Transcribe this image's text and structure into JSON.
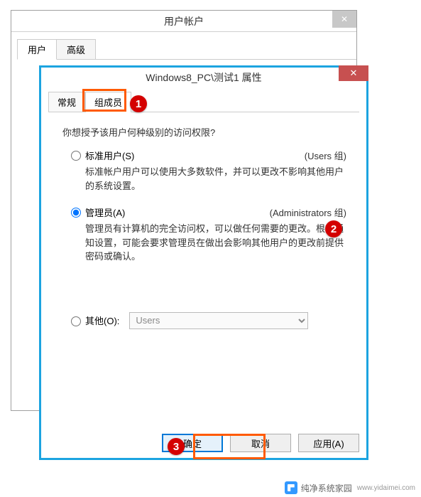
{
  "back_window": {
    "title": "用户帐户",
    "close": "✕",
    "tabs": [
      {
        "label": "用户"
      },
      {
        "label": "高级"
      }
    ]
  },
  "front_window": {
    "title": "Windows8_PC\\测试1 属性",
    "close": "✕",
    "tabs": [
      {
        "label": "常规"
      },
      {
        "label": "组成员"
      }
    ],
    "prompt": "你想授予该用户何种级别的访问权限?",
    "options": {
      "standard": {
        "label": "标准用户(S)",
        "group": "(Users 组)",
        "desc": "标准帐户用户可以使用大多数软件，并可以更改不影响其他用户的系统设置。"
      },
      "admin": {
        "label": "管理员(A)",
        "group": "(Administrators 组)",
        "desc": "管理员有计算机的完全访问权，可以做任何需要的更改。根据通知设置，可能会要求管理员在做出会影响其他用户的更改前提供密码或确认。"
      },
      "other": {
        "label": "其他(O):",
        "select_value": "Users"
      }
    },
    "buttons": {
      "ok": "确定",
      "cancel": "取消",
      "apply": "应用(A)"
    }
  },
  "badges": {
    "b1": "1",
    "b2": "2",
    "b3": "3"
  },
  "watermark": {
    "name": "纯净系统家园",
    "url": "www.yidaimei.com"
  }
}
